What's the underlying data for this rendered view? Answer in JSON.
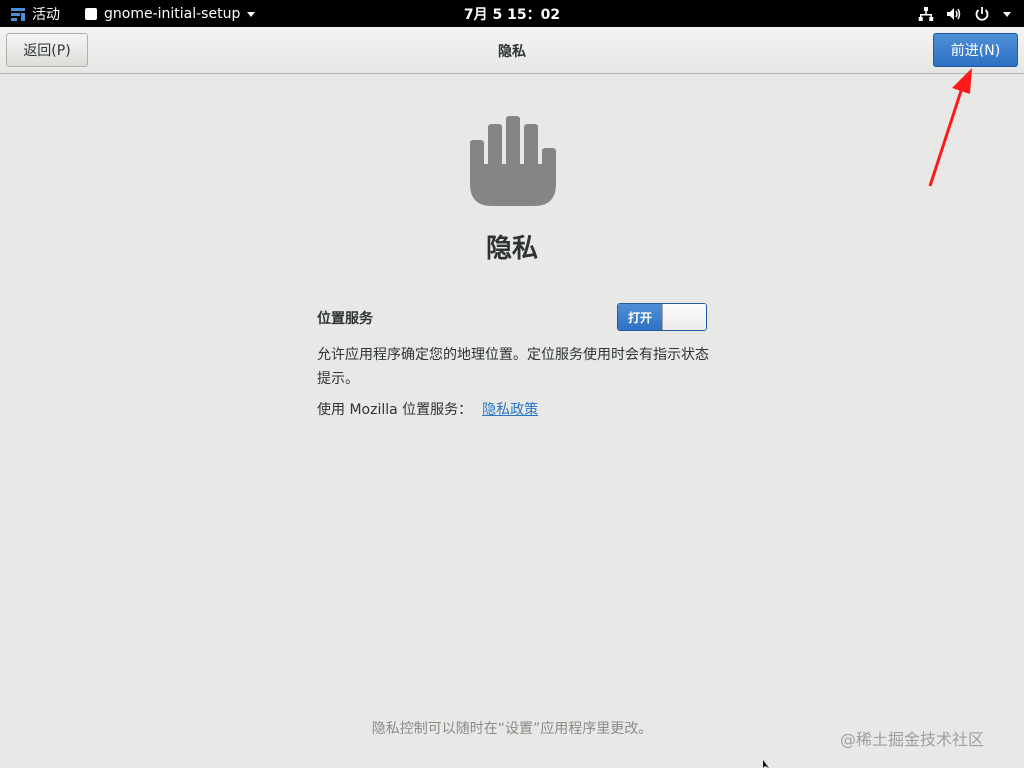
{
  "topbar": {
    "activities": "活动",
    "app_name": "gnome-initial-setup",
    "clock": "7月 5 15：02"
  },
  "headerbar": {
    "back_label": "返回(P)",
    "title": "隐私",
    "next_label": "前进(N)"
  },
  "main": {
    "title": "隐私",
    "location": {
      "label": "位置服务",
      "toggle_state": "打开",
      "description": "允许应用程序确定您的地理位置。定位服务使用时会有指示状态提示。",
      "mozilla_prefix": "使用 Mozilla 位置服务：",
      "privacy_link": "隐私政策"
    },
    "footer": "隐私控制可以随时在“设置”应用程序里更改。"
  },
  "watermark": "@稀土掘金技术社区",
  "colors": {
    "accent": "#3b7fce",
    "arrow": "#ff1a1a",
    "hand": "#858585"
  }
}
